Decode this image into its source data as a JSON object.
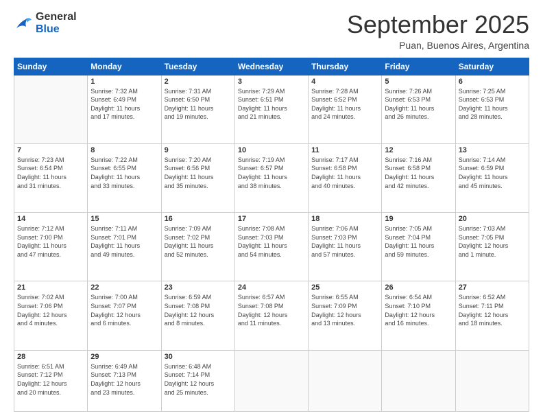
{
  "logo": {
    "line1": "General",
    "line2": "Blue"
  },
  "title": "September 2025",
  "location": "Puan, Buenos Aires, Argentina",
  "days_of_week": [
    "Sunday",
    "Monday",
    "Tuesday",
    "Wednesday",
    "Thursday",
    "Friday",
    "Saturday"
  ],
  "weeks": [
    [
      {
        "day": "",
        "info": ""
      },
      {
        "day": "1",
        "info": "Sunrise: 7:32 AM\nSunset: 6:49 PM\nDaylight: 11 hours\nand 17 minutes."
      },
      {
        "day": "2",
        "info": "Sunrise: 7:31 AM\nSunset: 6:50 PM\nDaylight: 11 hours\nand 19 minutes."
      },
      {
        "day": "3",
        "info": "Sunrise: 7:29 AM\nSunset: 6:51 PM\nDaylight: 11 hours\nand 21 minutes."
      },
      {
        "day": "4",
        "info": "Sunrise: 7:28 AM\nSunset: 6:52 PM\nDaylight: 11 hours\nand 24 minutes."
      },
      {
        "day": "5",
        "info": "Sunrise: 7:26 AM\nSunset: 6:53 PM\nDaylight: 11 hours\nand 26 minutes."
      },
      {
        "day": "6",
        "info": "Sunrise: 7:25 AM\nSunset: 6:53 PM\nDaylight: 11 hours\nand 28 minutes."
      }
    ],
    [
      {
        "day": "7",
        "info": "Sunrise: 7:23 AM\nSunset: 6:54 PM\nDaylight: 11 hours\nand 31 minutes."
      },
      {
        "day": "8",
        "info": "Sunrise: 7:22 AM\nSunset: 6:55 PM\nDaylight: 11 hours\nand 33 minutes."
      },
      {
        "day": "9",
        "info": "Sunrise: 7:20 AM\nSunset: 6:56 PM\nDaylight: 11 hours\nand 35 minutes."
      },
      {
        "day": "10",
        "info": "Sunrise: 7:19 AM\nSunset: 6:57 PM\nDaylight: 11 hours\nand 38 minutes."
      },
      {
        "day": "11",
        "info": "Sunrise: 7:17 AM\nSunset: 6:58 PM\nDaylight: 11 hours\nand 40 minutes."
      },
      {
        "day": "12",
        "info": "Sunrise: 7:16 AM\nSunset: 6:58 PM\nDaylight: 11 hours\nand 42 minutes."
      },
      {
        "day": "13",
        "info": "Sunrise: 7:14 AM\nSunset: 6:59 PM\nDaylight: 11 hours\nand 45 minutes."
      }
    ],
    [
      {
        "day": "14",
        "info": "Sunrise: 7:12 AM\nSunset: 7:00 PM\nDaylight: 11 hours\nand 47 minutes."
      },
      {
        "day": "15",
        "info": "Sunrise: 7:11 AM\nSunset: 7:01 PM\nDaylight: 11 hours\nand 49 minutes."
      },
      {
        "day": "16",
        "info": "Sunrise: 7:09 AM\nSunset: 7:02 PM\nDaylight: 11 hours\nand 52 minutes."
      },
      {
        "day": "17",
        "info": "Sunrise: 7:08 AM\nSunset: 7:03 PM\nDaylight: 11 hours\nand 54 minutes."
      },
      {
        "day": "18",
        "info": "Sunrise: 7:06 AM\nSunset: 7:03 PM\nDaylight: 11 hours\nand 57 minutes."
      },
      {
        "day": "19",
        "info": "Sunrise: 7:05 AM\nSunset: 7:04 PM\nDaylight: 11 hours\nand 59 minutes."
      },
      {
        "day": "20",
        "info": "Sunrise: 7:03 AM\nSunset: 7:05 PM\nDaylight: 12 hours\nand 1 minute."
      }
    ],
    [
      {
        "day": "21",
        "info": "Sunrise: 7:02 AM\nSunset: 7:06 PM\nDaylight: 12 hours\nand 4 minutes."
      },
      {
        "day": "22",
        "info": "Sunrise: 7:00 AM\nSunset: 7:07 PM\nDaylight: 12 hours\nand 6 minutes."
      },
      {
        "day": "23",
        "info": "Sunrise: 6:59 AM\nSunset: 7:08 PM\nDaylight: 12 hours\nand 8 minutes."
      },
      {
        "day": "24",
        "info": "Sunrise: 6:57 AM\nSunset: 7:08 PM\nDaylight: 12 hours\nand 11 minutes."
      },
      {
        "day": "25",
        "info": "Sunrise: 6:55 AM\nSunset: 7:09 PM\nDaylight: 12 hours\nand 13 minutes."
      },
      {
        "day": "26",
        "info": "Sunrise: 6:54 AM\nSunset: 7:10 PM\nDaylight: 12 hours\nand 16 minutes."
      },
      {
        "day": "27",
        "info": "Sunrise: 6:52 AM\nSunset: 7:11 PM\nDaylight: 12 hours\nand 18 minutes."
      }
    ],
    [
      {
        "day": "28",
        "info": "Sunrise: 6:51 AM\nSunset: 7:12 PM\nDaylight: 12 hours\nand 20 minutes."
      },
      {
        "day": "29",
        "info": "Sunrise: 6:49 AM\nSunset: 7:13 PM\nDaylight: 12 hours\nand 23 minutes."
      },
      {
        "day": "30",
        "info": "Sunrise: 6:48 AM\nSunset: 7:14 PM\nDaylight: 12 hours\nand 25 minutes."
      },
      {
        "day": "",
        "info": ""
      },
      {
        "day": "",
        "info": ""
      },
      {
        "day": "",
        "info": ""
      },
      {
        "day": "",
        "info": ""
      }
    ]
  ]
}
